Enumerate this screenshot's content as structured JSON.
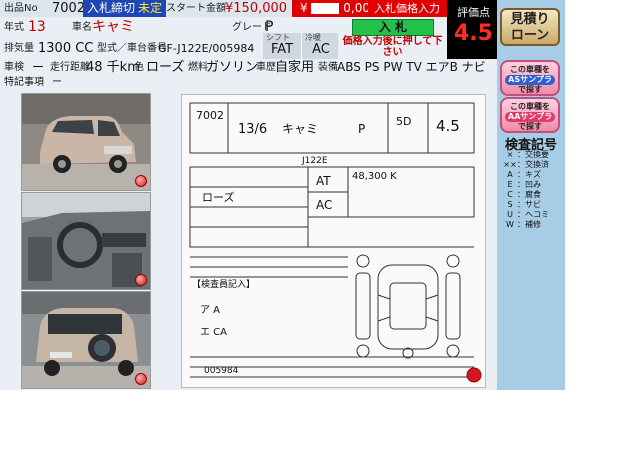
{
  "header": {
    "lot_label": "出品No",
    "lot_no": "7002",
    "bid_status": "入札締切",
    "bid_status_sub": "未定",
    "start_price_label": "スタート金額",
    "start_price": "¥150,000",
    "bid_price_prefix": "¥",
    "bid_price_value": "0,000",
    "bid_input_label": "入札価格入力",
    "score_label": "評価点",
    "score": "4.5"
  },
  "vehicle": {
    "year_label": "年式",
    "year": "13",
    "model_label": "車名",
    "model": "キャミ",
    "grade_label": "グレード",
    "grade": "P",
    "displacement_label": "排気量",
    "displacement": "1300 CC",
    "chassis_label": "型式／車台番号",
    "chassis": "GF-J122E/005984",
    "shift_label": "シフト",
    "shift": "FAT",
    "ac_label": "冷暖",
    "ac": "AC",
    "inspection_label": "車検",
    "inspection": "ー",
    "mileage_label": "走行距離",
    "mileage": "48 千km",
    "color_label": "色",
    "color": "ローズ",
    "fuel_label": "燃料",
    "fuel": "ガソリン",
    "usage_label": "車歴",
    "usage": "自家用",
    "equipment_label": "装備",
    "equipment": "ABS PS PW TV エアB ナビ",
    "notes_label": "特記事項",
    "notes": "ー"
  },
  "bid": {
    "button": "入 札",
    "note": "価格入力後に押して下さい"
  },
  "sidebar": {
    "quote_button": "見積り\nローン",
    "search_as_top": "この車種を",
    "search_as_brand": "ASサンプラ",
    "search_as_bottom": "で探す",
    "search_aa_top": "この車種を",
    "search_aa_brand": "AAサンプラ",
    "search_aa_bottom": "で探す",
    "legend_title": "検査記号",
    "legend": [
      {
        "k": "×",
        "v": "：交換要"
      },
      {
        "k": "××",
        "v": "：交換済"
      },
      {
        "k": "A",
        "v": "：キズ"
      },
      {
        "k": "E",
        "v": "：凹み"
      },
      {
        "k": "C",
        "v": "：腐食"
      },
      {
        "k": "S",
        "v": "：サビ"
      },
      {
        "k": "U",
        "v": "：ヘコミ"
      },
      {
        "k": "W",
        "v": "：補修"
      }
    ]
  },
  "sheet": {
    "lot": "7002",
    "year": "13/6",
    "name": "キャミ",
    "grade": "P",
    "doors": "5D",
    "score": "4.5",
    "chassis": "J122E",
    "mileage": "48,300 K",
    "color": "ローズ",
    "trans": "AT",
    "ac": "AC",
    "section": "【検査員記入】",
    "ca1": "ア A",
    "ca2": "エ CA",
    "footer_no": "005984"
  }
}
